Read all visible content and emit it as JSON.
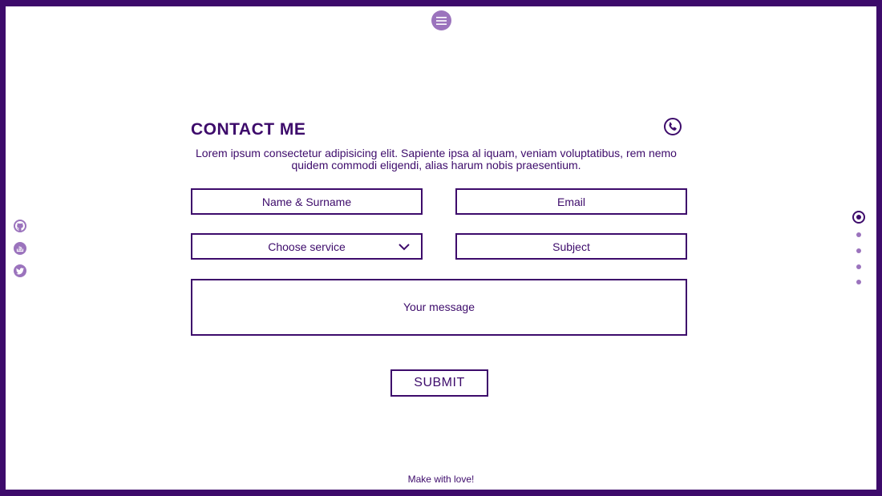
{
  "colors": {
    "primary": "#3d0b6b",
    "accent": "#9b73bd"
  },
  "header": {
    "menu_icon": "hamburger-menu-icon"
  },
  "contact": {
    "title": "CONTACT ME",
    "title_icon": "phone-icon",
    "intro": "Lorem ipsum consectetur adipisicing elit. Sapiente ipsa al iquam, veniam voluptatibus, rem nemo quidem commodi eligendi, alias harum nobis praesentium."
  },
  "form": {
    "name_placeholder": "Name & Surname",
    "email_placeholder": "Email",
    "service_selected": "Choose service",
    "subject_placeholder": "Subject",
    "message_placeholder": "Your message",
    "submit_label": "SUBMIT"
  },
  "social": [
    "github-icon",
    "stack-overflow-icon",
    "twitter-icon"
  ],
  "page_nav": {
    "total": 5,
    "active": 1
  },
  "footer": {
    "text": "Make with love!"
  }
}
